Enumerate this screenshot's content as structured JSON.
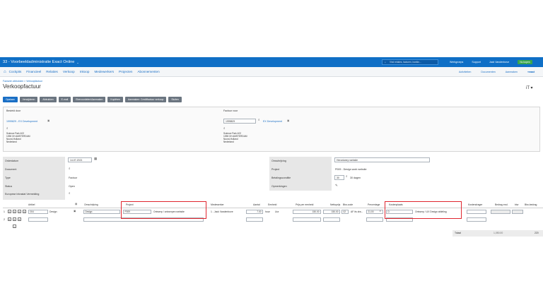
{
  "topbar": {
    "title": "33 - Voorbeeldadministratie Exact Online",
    "caret": "⌄",
    "search_placeholder": "Vind relaties, facturen, boekin...",
    "links": [
      "Werkgroeps",
      "Support",
      "Jack Vandenbove"
    ],
    "badge": "Nu kopen"
  },
  "nav": {
    "items": [
      "Cockpits",
      "Financieel",
      "Relaties",
      "Verkoop",
      "Inkoop",
      "Medewerkers",
      "Projecten",
      "Abonnementen"
    ],
    "right": [
      "Activiteiten",
      "Documenten",
      "Aanmaken"
    ],
    "logo": "≡exact"
  },
  "breadcrumb": "Facturen afdrukken > Verkoopfactuur",
  "page_title": "Verkoopfactuur",
  "rtool": "iT ▾",
  "buttons": [
    "Opslaan",
    "Verwijderen",
    "Afdrukken",
    "E-mail",
    "Ebevoordelen/Aanmaken",
    "Kopiëren",
    "Aanmaken: Creditfactuur verkoop",
    "Sluiten"
  ],
  "header": {
    "delivered_to_label": "Besteld door",
    "delivered_to_value": "1999829 - EX Development",
    "delivered_to_address": "Science Park 402\n1098 XH AMSTERDAM\nNoord-Holland\nNederland",
    "invoice_to_label": "Factuur voor",
    "invoice_to_code": "1999829",
    "invoice_to_name": "EX Development",
    "invoice_to_address": "Science Park 402\n1098 XH AMSTERDAM\nNoord-Holland\nNederland"
  },
  "fields_left": [
    {
      "label": "Orderdatum",
      "value": "14-07-2021"
    },
    {
      "label": "Document",
      "value": ""
    },
    {
      "label": "Type",
      "value": "Factuur"
    },
    {
      "label": "Status",
      "value": "Open"
    },
    {
      "label": "Europese Intrastat Vermelding",
      "value": ""
    }
  ],
  "fields_right": [
    {
      "label": "Omschrijving",
      "value": "Herontwerp website"
    },
    {
      "label": "Project",
      "value": "P009 - Design work website"
    },
    {
      "label": "Betalingsconditie",
      "value": "30",
      "extra": "30 dagen"
    },
    {
      "label": "Opmerkingen",
      "value": ""
    }
  ],
  "grid": {
    "headers": [
      "Artikel",
      "Omschrijving",
      "Project",
      "Medewerker",
      "Aantal",
      "Eenheid",
      "Prijs per eenheid",
      "Nettoprijs",
      "Btw-code",
      "Percentage",
      "Kostenplaats",
      "Kostendrager",
      "Bedrag excl.",
      "btw",
      "Btw-bedrag"
    ],
    "row1": {
      "num": "1",
      "article_code": "004",
      "article_name": "Design",
      "description": "Design",
      "project_code": "P009",
      "project_name": "Ontwerp / ontwerpen website",
      "employee": "1 - Jack Vandenbove",
      "qty": "7.00",
      "unit": "hour",
      "unit_name": "Uur",
      "price": "150.00",
      "net": "150.00",
      "vat_code": "02",
      "vat_name": "AF its dra...",
      "pct": "21.00",
      "costcenter_code": "D",
      "costcenter_name": "Ontwerp / UX Design afdeling"
    },
    "row2_num": "2"
  },
  "totals": {
    "label": "Totaal",
    "excl": "1,050.00",
    "right": "220"
  }
}
